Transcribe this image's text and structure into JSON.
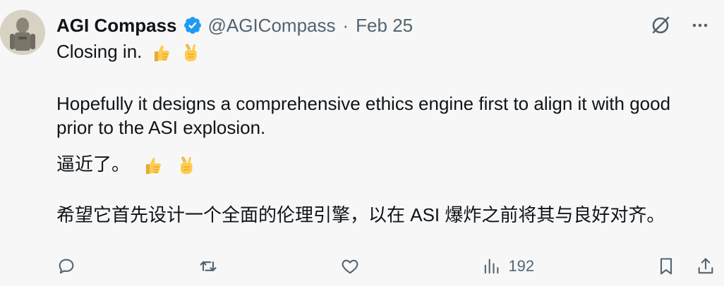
{
  "author": {
    "name": "AGI Compass",
    "handle": "@AGICompass",
    "separator": "·",
    "date": "Feb 25"
  },
  "tweet": {
    "line1": "Closing in.",
    "line2": "Hopefully it designs a comprehensive ethics engine first to align it with good prior to the ASI explosion.",
    "line3": "逼近了。",
    "line4": "希望它首先设计一个全面的伦理引擎，以在 ASI 爆炸之前将其与良好对齐。"
  },
  "actions": {
    "views_count": "192"
  },
  "icons": {
    "verified": "verified-badge-icon",
    "grok": "grok-icon",
    "more": "more-icon",
    "reply": "reply-icon",
    "retweet": "retweet-icon",
    "like": "like-icon",
    "views": "views-icon",
    "bookmark": "bookmark-icon",
    "share": "share-icon"
  },
  "colors": {
    "verified_blue": "#1d9bf0",
    "text_primary": "#0f1419",
    "text_secondary": "#536471",
    "background": "#f7f7f7"
  }
}
